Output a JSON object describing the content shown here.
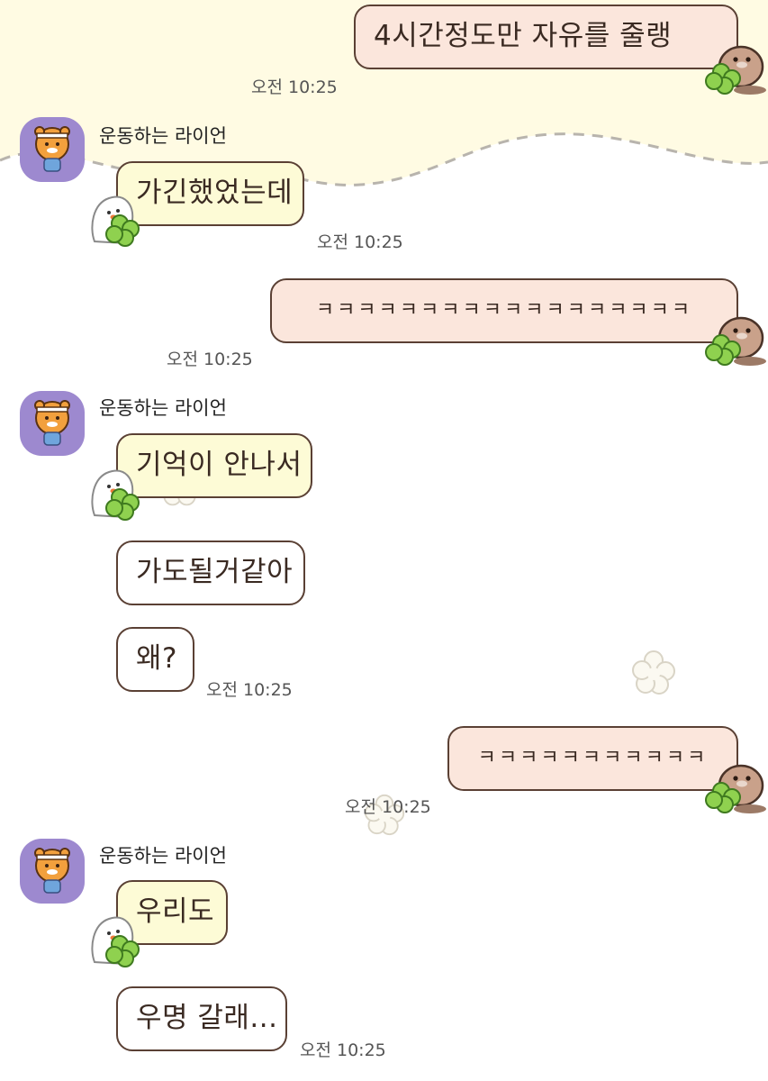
{
  "sender_name": "운동하는 라이언",
  "colors": {
    "my_bubble": "#fbe6dc",
    "friend_first_bubble": "#fdfbd6",
    "friend_bubble": "#ffffff",
    "bubble_border": "#5a4034",
    "top_background": "#fffbe3"
  },
  "icons": {
    "avatar": "ryan-running-avatar",
    "my_sticker": "sea-lion-clover-icon",
    "friend_sticker": "white-ghost-clover-icon",
    "decoration": "flower-icon"
  },
  "messages": [
    {
      "side": "me",
      "text": "4시간정도만 자유를 줄랭",
      "time": "오전 10:25"
    },
    {
      "side": "friend",
      "text": "가긴했었는데",
      "time": "오전 10:25"
    },
    {
      "side": "me",
      "text": "ㅋㅋㅋㅋㅋㅋㅋㅋㅋㅋㅋㅋㅋㅋㅋㅋㅋㅋ",
      "time": "오전 10:25"
    },
    {
      "side": "friend",
      "text": "기억이 안나서"
    },
    {
      "side": "friend",
      "text": "가도될거같아"
    },
    {
      "side": "friend",
      "text": "왜?",
      "time": "오전 10:25"
    },
    {
      "side": "me",
      "text": "ㅋㅋㅋㅋㅋㅋㅋㅋㅋㅋㅋ",
      "time": "오전 10:25"
    },
    {
      "side": "friend",
      "text": "우리도"
    },
    {
      "side": "friend",
      "text": "우명 갈래...",
      "time": "오전 10:25"
    }
  ]
}
